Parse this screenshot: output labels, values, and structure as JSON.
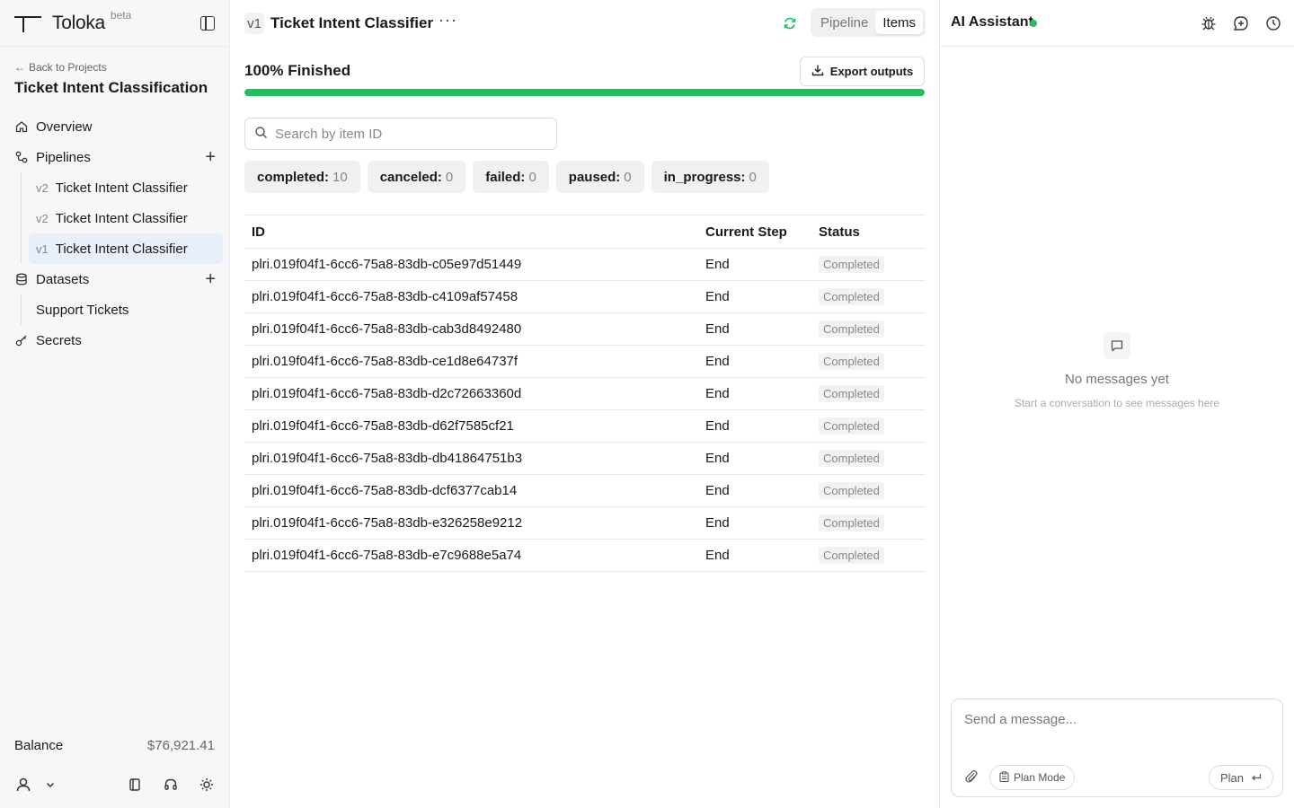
{
  "brand": {
    "name": "Toloka",
    "tag": "beta"
  },
  "sidebar": {
    "back_label": "Back to Projects",
    "project_title": "Ticket Intent Classification",
    "nav": {
      "overview": "Overview",
      "pipelines": "Pipelines",
      "datasets": "Datasets",
      "secrets": "Secrets"
    },
    "pipelines": [
      {
        "version": "v2",
        "name": "Ticket Intent Classifier"
      },
      {
        "version": "v2",
        "name": "Ticket Intent Classifier"
      },
      {
        "version": "v1",
        "name": "Ticket Intent Classifier"
      }
    ],
    "datasets": [
      {
        "name": "Support Tickets"
      }
    ],
    "balance_label": "Balance",
    "balance_value": "$76,921.41"
  },
  "main": {
    "version": "v1",
    "title": "Ticket Intent Classifier",
    "more": "···",
    "tabs": {
      "pipeline": "Pipeline",
      "items": "Items"
    },
    "progress_title": "100% Finished",
    "progress_fraction": 1.0,
    "export_label": "Export outputs",
    "search_placeholder": "Search by item ID",
    "chips": [
      {
        "label": "completed:",
        "count": "10"
      },
      {
        "label": "canceled:",
        "count": "0"
      },
      {
        "label": "failed:",
        "count": "0"
      },
      {
        "label": "paused:",
        "count": "0"
      },
      {
        "label": "in_progress:",
        "count": "0"
      }
    ],
    "table": {
      "headers": {
        "id": "ID",
        "step": "Current Step",
        "status": "Status"
      },
      "rows": [
        {
          "id": "plri.019f04f1-6cc6-75a8-83db-c05e97d51449",
          "step": "End",
          "status": "Completed"
        },
        {
          "id": "plri.019f04f1-6cc6-75a8-83db-c4109af57458",
          "step": "End",
          "status": "Completed"
        },
        {
          "id": "plri.019f04f1-6cc6-75a8-83db-cab3d8492480",
          "step": "End",
          "status": "Completed"
        },
        {
          "id": "plri.019f04f1-6cc6-75a8-83db-ce1d8e64737f",
          "step": "End",
          "status": "Completed"
        },
        {
          "id": "plri.019f04f1-6cc6-75a8-83db-d2c72663360d",
          "step": "End",
          "status": "Completed"
        },
        {
          "id": "plri.019f04f1-6cc6-75a8-83db-d62f7585cf21",
          "step": "End",
          "status": "Completed"
        },
        {
          "id": "plri.019f04f1-6cc6-75a8-83db-db41864751b3",
          "step": "End",
          "status": "Completed"
        },
        {
          "id": "plri.019f04f1-6cc6-75a8-83db-dcf6377cab14",
          "step": "End",
          "status": "Completed"
        },
        {
          "id": "plri.019f04f1-6cc6-75a8-83db-e326258e9212",
          "step": "End",
          "status": "Completed"
        },
        {
          "id": "plri.019f04f1-6cc6-75a8-83db-e7c9688e5a74",
          "step": "End",
          "status": "Completed"
        }
      ]
    }
  },
  "assistant": {
    "title": "AI Assistant",
    "empty_title": "No messages yet",
    "empty_sub": "Start a conversation to see messages here",
    "input_placeholder": "Send a message...",
    "plan_mode_label": "Plan Mode",
    "plan_label": "Plan"
  },
  "colors": {
    "accent_green": "#1fbf5b",
    "active_bg": "#e9eefb"
  },
  "icons": [
    "panel-left-icon",
    "arrow-left-icon",
    "home-icon",
    "pipeline-icon",
    "plus-icon",
    "database-icon",
    "key-icon",
    "user-icon",
    "chevron-down-icon",
    "book-icon",
    "headset-icon",
    "sun-icon",
    "sync-icon",
    "download-icon",
    "search-icon",
    "bug-icon",
    "new-chat-icon",
    "history-icon",
    "message-icon",
    "paperclip-icon",
    "clipboard-icon",
    "enter-icon"
  ]
}
